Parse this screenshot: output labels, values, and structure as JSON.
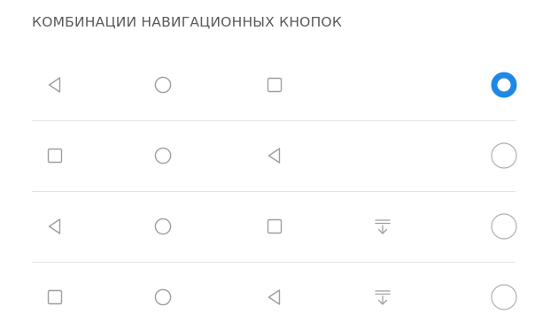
{
  "section": {
    "title": "КОМБИНАЦИИ НАВИГАЦИОННЫХ КНОПОК"
  },
  "colors": {
    "accent": "#1e88e5",
    "icon": "#9e9e9e",
    "radio_off": "#b0b0b0",
    "divider": "#e3e3e3",
    "title": "#5a5a5a"
  },
  "options": [
    {
      "icons": [
        "back-icon",
        "home-icon",
        "recents-icon"
      ],
      "selected": true
    },
    {
      "icons": [
        "recents-icon",
        "home-icon",
        "back-icon"
      ],
      "selected": false
    },
    {
      "icons": [
        "back-icon",
        "home-icon",
        "recents-icon",
        "notification-pull-icon"
      ],
      "selected": false
    },
    {
      "icons": [
        "recents-icon",
        "home-icon",
        "back-icon",
        "notification-pull-icon"
      ],
      "selected": false
    }
  ]
}
